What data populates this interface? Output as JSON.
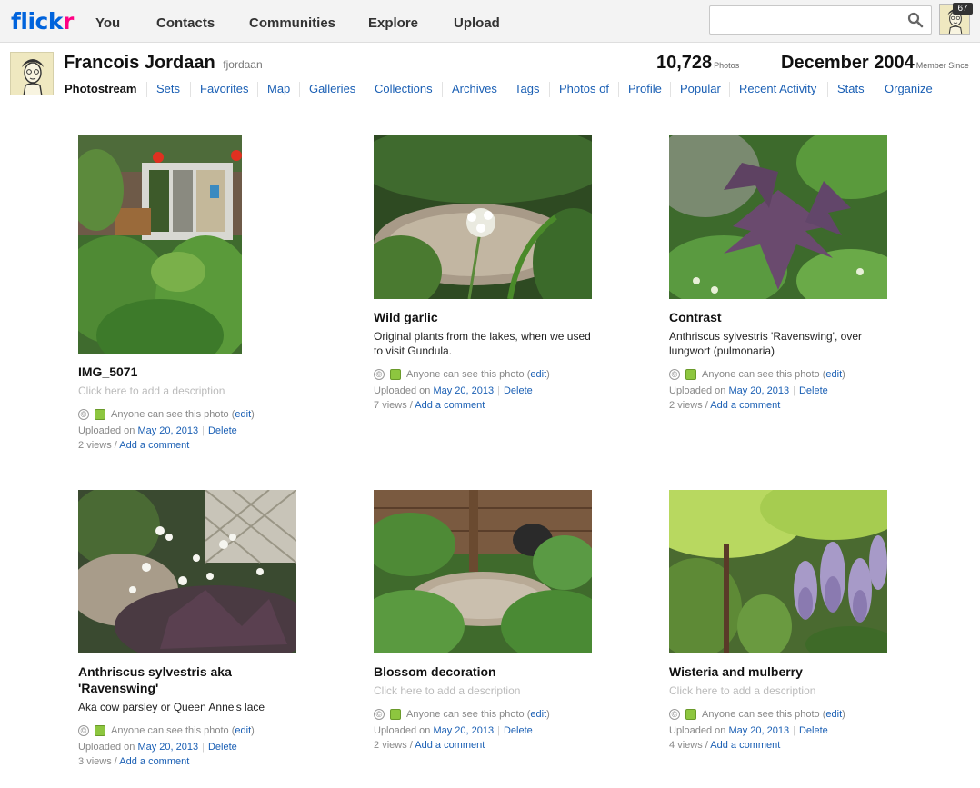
{
  "logo": {
    "part1": "flick",
    "part2": "r"
  },
  "topnav": [
    "You",
    "Contacts",
    "Communities",
    "Explore",
    "Upload"
  ],
  "search": {
    "value": "",
    "placeholder": ""
  },
  "notifications": {
    "count": "67"
  },
  "profile": {
    "name": "Francois Jordaan",
    "username": "fjordaan",
    "photos_count": "10,728",
    "photos_label": "Photos",
    "member_since": "December 2004",
    "member_label": "Member Since"
  },
  "subnav": [
    "Photostream",
    "Sets",
    "Favorites",
    "Map",
    "Galleries",
    "Collections",
    "Archives",
    "Tags",
    "Photos of",
    "Profile",
    "Popular",
    "Recent Activity",
    "Stats",
    "Organize"
  ],
  "common": {
    "anyone": "Anyone can see this photo",
    "edit": "edit",
    "uploaded_on": "Uploaded on",
    "delete": "Delete",
    "add_comment": "Add a comment",
    "views_suffix": "views /",
    "license_glyph": "©"
  },
  "photos": [
    {
      "title": "IMG_5071",
      "description": "Click here to add a description",
      "date": "May 20, 2013",
      "views": "2"
    },
    {
      "title": "Wild garlic",
      "description": "Original plants from the lakes, when we used to visit Gundula.",
      "date": "May 20, 2013",
      "views": "7"
    },
    {
      "title": "Contrast",
      "description": "Anthriscus sylvestris 'Ravenswing', over lungwort (pulmonaria)",
      "date": "May 20, 2013",
      "views": "2"
    },
    {
      "title": "Anthriscus sylvestris aka 'Ravenswing'",
      "description": "Aka cow parsley or Queen Anne's lace",
      "date": "May 20, 2013",
      "views": "3"
    },
    {
      "title": "Blossom decoration",
      "description": "Click here to add a description",
      "date": "May 20, 2013",
      "views": "2"
    },
    {
      "title": "Wisteria and mulberry",
      "description": "Click here to add a description",
      "date": "May 20, 2013",
      "views": "4"
    }
  ]
}
